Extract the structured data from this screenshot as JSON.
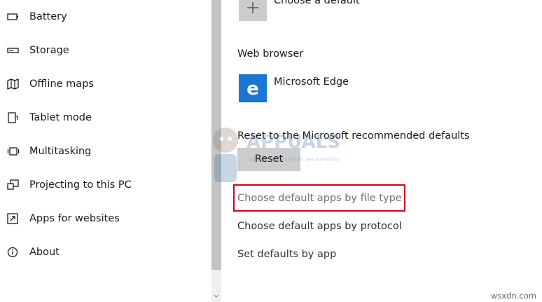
{
  "sidebar": {
    "items": [
      {
        "label": "Battery",
        "icon": "battery-icon"
      },
      {
        "label": "Storage",
        "icon": "storage-icon"
      },
      {
        "label": "Offline maps",
        "icon": "map-icon"
      },
      {
        "label": "Tablet mode",
        "icon": "tablet-icon"
      },
      {
        "label": "Multitasking",
        "icon": "multitasking-icon"
      },
      {
        "label": "Projecting to this PC",
        "icon": "projecting-icon"
      },
      {
        "label": "Apps for websites",
        "icon": "apps-websites-icon"
      },
      {
        "label": "About",
        "icon": "info-icon"
      }
    ]
  },
  "main": {
    "choose_default_label": "Choose a default",
    "web_browser": {
      "heading": "Web browser",
      "app_name": "Microsoft Edge",
      "app_icon": "microsoft-edge-icon",
      "app_glyph": "e",
      "tile_color": "#1976d2"
    },
    "reset": {
      "description": "Reset to the Microsoft recommended defaults",
      "button_label": "Reset"
    },
    "links": {
      "by_file_type": "Choose default apps by file type",
      "by_protocol": "Choose default apps by protocol",
      "by_app": "Set defaults by app"
    },
    "highlight_color": "#d0021b"
  },
  "watermark": {
    "brand": "APPUALS",
    "tagline": "TECH HOW-TO'S FROM THE EXPERTS!"
  },
  "site_watermark": "wsxdn.com"
}
